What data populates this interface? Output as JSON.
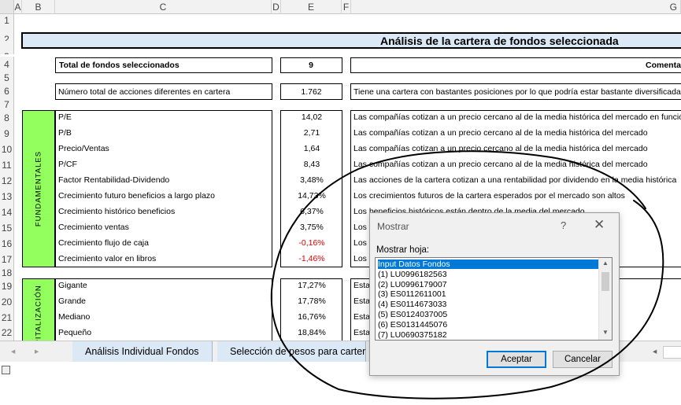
{
  "columns": [
    "A",
    "B",
    "C",
    "D",
    "E",
    "F",
    "G"
  ],
  "rows": [
    "1",
    "2",
    "3",
    "4",
    "5",
    "6",
    "7",
    "8",
    "9",
    "10",
    "11",
    "12",
    "13",
    "14",
    "15",
    "16",
    "17",
    "18",
    "19",
    "20",
    "21",
    "22"
  ],
  "title": "Análisis de la cartera de fondos seleccionada",
  "total_label": "Total de fondos seleccionados",
  "total_value": "9",
  "comment_header": "Comenta",
  "acciones_label": "Número total de acciones diferentes en cartera",
  "acciones_value": "1.762",
  "acciones_comment": "Tiene una cartera con bastantes posiciones por lo que podría estar bastante diversificada",
  "fundamentales_label": "FUNDAMENTALES",
  "capitalizacion_label": "CAPITALIZACIÓN",
  "fundamentales": [
    {
      "label": "P/E",
      "value": "14,02",
      "comment": "Las compañías cotizan a un precio cercano al de la media histórica del mercado en función"
    },
    {
      "label": "P/B",
      "value": "2,71",
      "comment": "Las compañías cotizan a un precio cercano al de la media histórica del mercado"
    },
    {
      "label": "Precio/Ventas",
      "value": "1,64",
      "comment": "Las compañías cotizan a un precio cercano al de la media histórica del mercado"
    },
    {
      "label": "P/CF",
      "value": "8,43",
      "comment": "Las compañías cotizan a un precio cercano al de la media histórica del mercado"
    },
    {
      "label": "Factor Rentabilidad-Dividendo",
      "value": "3,48%",
      "comment": "Las acciones de la cartera cotizan a una rentabilidad por dividendo en la media histórica"
    },
    {
      "label": "Crecimiento futuro beneficios a largo plazo",
      "value": "14,73%",
      "comment": "Los crecimientos futuros de la cartera esperados por el mercado son altos"
    },
    {
      "label": "Crecimiento histórico beneficios",
      "value": "6,37%",
      "comment": "Los beneficios históricos están dentro de la media del mercado"
    },
    {
      "label": "Crecimiento ventas",
      "value": "3,75%",
      "comment": "Los b"
    },
    {
      "label": "Crecimiento flujo de caja",
      "value": "-0,16%",
      "comment": "Los c"
    },
    {
      "label": "Crecimiento valor en libros",
      "value": "-1,46%",
      "comment": "Los c"
    }
  ],
  "capitalizacion": [
    {
      "label": "Gigante",
      "value": "17,27%",
      "comment": "Esta"
    },
    {
      "label": "Grande",
      "value": "17,78%",
      "comment": "Esta"
    },
    {
      "label": "Mediano",
      "value": "16,76%",
      "comment": "Esta"
    },
    {
      "label": "Pequeño",
      "value": "18,84%",
      "comment": "Esta"
    }
  ],
  "tabs": [
    "Análisis Individual Fondos",
    "Selección de pesos para carter"
  ],
  "dialog": {
    "title": "Mostrar",
    "help": "?",
    "close": "✕",
    "label": "Mostrar hoja:",
    "items": [
      "Input Datos Fondos",
      "(1) LU0996182563",
      "(2) LU0996179007",
      "(3) ES0112611001",
      "(4) ES0114673033",
      "(5) ES0124037005",
      "(6) ES0131445076",
      "(7) LU0690375182"
    ],
    "ok": "Aceptar",
    "cancel": "Cancelar"
  },
  "colors": {
    "accent": "#0078d7",
    "green_band": "#92ff5e",
    "title_band": "#dbe9f6",
    "negative": "#e00000"
  }
}
